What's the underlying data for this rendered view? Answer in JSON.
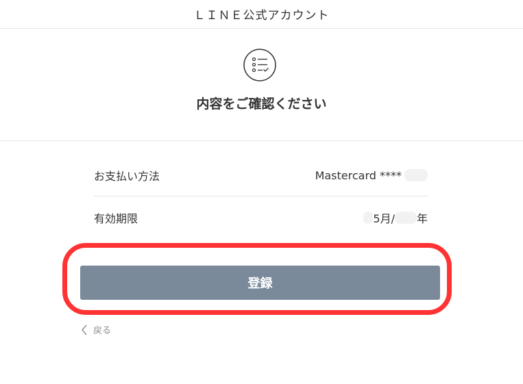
{
  "header": {
    "title": "ＬＩＮＥ公式アカウント"
  },
  "confirm": {
    "icon": "checklist-icon",
    "title": "内容をご確認ください"
  },
  "details": [
    {
      "label": "お支払い方法",
      "value": "Mastercard ****"
    },
    {
      "label": "有効期限",
      "value_month": "5月/",
      "value_year": "年"
    }
  ],
  "actions": {
    "register_label": "登録",
    "back_label": "戻る"
  },
  "colors": {
    "button": "#7b8a9b",
    "highlight": "#ff3333",
    "divider": "#e5e5e5"
  }
}
